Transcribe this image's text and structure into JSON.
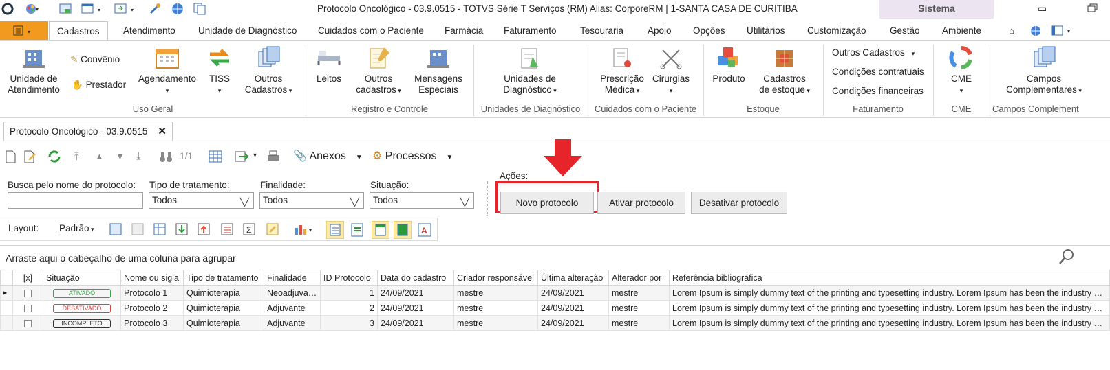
{
  "window": {
    "title": "Protocolo Oncológico - 03.9.0515 - TOTVS Série T Serviços (RM) Alias: CorporeRM | 1-SANTA CASA DE CURITIBA",
    "sistema_label": "Sistema"
  },
  "ribbon_tabs": [
    "Cadastros",
    "Atendimento",
    "Unidade de Diagnóstico",
    "Cuidados com o Paciente",
    "Farmácia",
    "Faturamento",
    "Tesouraria",
    "Apoio",
    "Opções",
    "Utilitários",
    "Customização",
    "Gestão",
    "Ambiente"
  ],
  "ribbon": {
    "unidade_atendimento": "Unidade de\nAtendimento",
    "convenio": "Convênio",
    "prestador": "Prestador",
    "agendamento": "Agendamento",
    "tiss": "TISS",
    "outros_cadastros": "Outros\nCadastros",
    "grp_uso_geral": "Uso Geral",
    "leitos": "Leitos",
    "outros_cadastros2": "Outros\ncadastros",
    "mensagens": "Mensagens\nEspeciais",
    "grp_registro": "Registro e Controle",
    "unidades_diag": "Unidades de\nDiagnóstico",
    "grp_unidades_diag": "Unidades de Diagnóstico",
    "prescricao": "Prescrição\nMédica",
    "cirurgias": "Cirurgias",
    "grp_cuidados": "Cuidados com o Paciente",
    "produto": "Produto",
    "cadastros_estoque": "Cadastros\nde estoque",
    "grp_estoque": "Estoque",
    "outros_cad_menu": "Outros Cadastros",
    "cond_contratuais": "Condições contratuais",
    "cond_financeiras": "Condições financeiras",
    "grp_faturamento": "Faturamento",
    "cme": "CME",
    "grp_cme": "CME",
    "campos_compl": "Campos\nComplementares",
    "grp_campos": "Campos Complement"
  },
  "doc_tab": "Protocolo Oncológico - 03.9.0515",
  "toolbar": {
    "record_counter": "1/1",
    "anexos": "Anexos",
    "processos": "Processos"
  },
  "filters": {
    "busca_label": "Busca pelo nome do protocolo:",
    "busca_value": "",
    "tipo_label": "Tipo de tratamento:",
    "tipo_value": "Todos",
    "finalidade_label": "Finalidade:",
    "finalidade_value": "Todos",
    "situacao_label": "Situação:",
    "situacao_value": "Todos"
  },
  "acoes": {
    "label": "Ações:",
    "novo": "Novo protocolo",
    "ativar": "Ativar protocolo",
    "desativar": "Desativar protocolo"
  },
  "layout_bar": {
    "layout_label": "Layout:",
    "padrao": "Padrão"
  },
  "group_area": "Arraste aqui o cabeçalho de uma coluna para agrupar",
  "grid": {
    "columns": [
      "[x]",
      "Situação",
      "Nome ou sigla",
      "Tipo de tratamento",
      "Finalidade",
      "ID Protocolo",
      "Data do cadastro",
      "Criador responsável",
      "Última alteração",
      "Alterador por",
      "Referência bibliográfica"
    ],
    "rows": [
      {
        "situacao": "ATIVADO",
        "nome": "Protocolo 1",
        "tipo": "Quimioterapia",
        "finalidade": "Neoadjuvante",
        "id": "1",
        "data": "24/09/2021",
        "criador": "mestre",
        "alteracao": "24/09/2021",
        "alterador": "mestre",
        "referencia": "Lorem Ipsum is simply dummy text of the printing and typesetting industry. Lorem Ipsum has been the industry sta..."
      },
      {
        "situacao": "DESATIVADO",
        "nome": "Protocolo 2",
        "tipo": "Quimioterapia",
        "finalidade": "Adjuvante",
        "id": "2",
        "data": "24/09/2021",
        "criador": "mestre",
        "alteracao": "24/09/2021",
        "alterador": "mestre",
        "referencia": "Lorem Ipsum is simply dummy text of the printing and typesetting industry. Lorem Ipsum has been the industry sta..."
      },
      {
        "situacao": "INCOMPLETO",
        "nome": "Protocolo 3",
        "tipo": "Quimioterapia",
        "finalidade": "Adjuvante",
        "id": "3",
        "data": "24/09/2021",
        "criador": "mestre",
        "alteracao": "24/09/2021",
        "alterador": "mestre",
        "referencia": "Lorem Ipsum is simply dummy text of the printing and typesetting industry. Lorem Ipsum has been the industry sta..."
      }
    ]
  },
  "colors": {
    "accent_orange": "#f29a1f",
    "highlight_red": "#e8242b",
    "status_ativado": "#2aa845",
    "status_desativado": "#e0443c",
    "status_incompleto": "#333333"
  }
}
